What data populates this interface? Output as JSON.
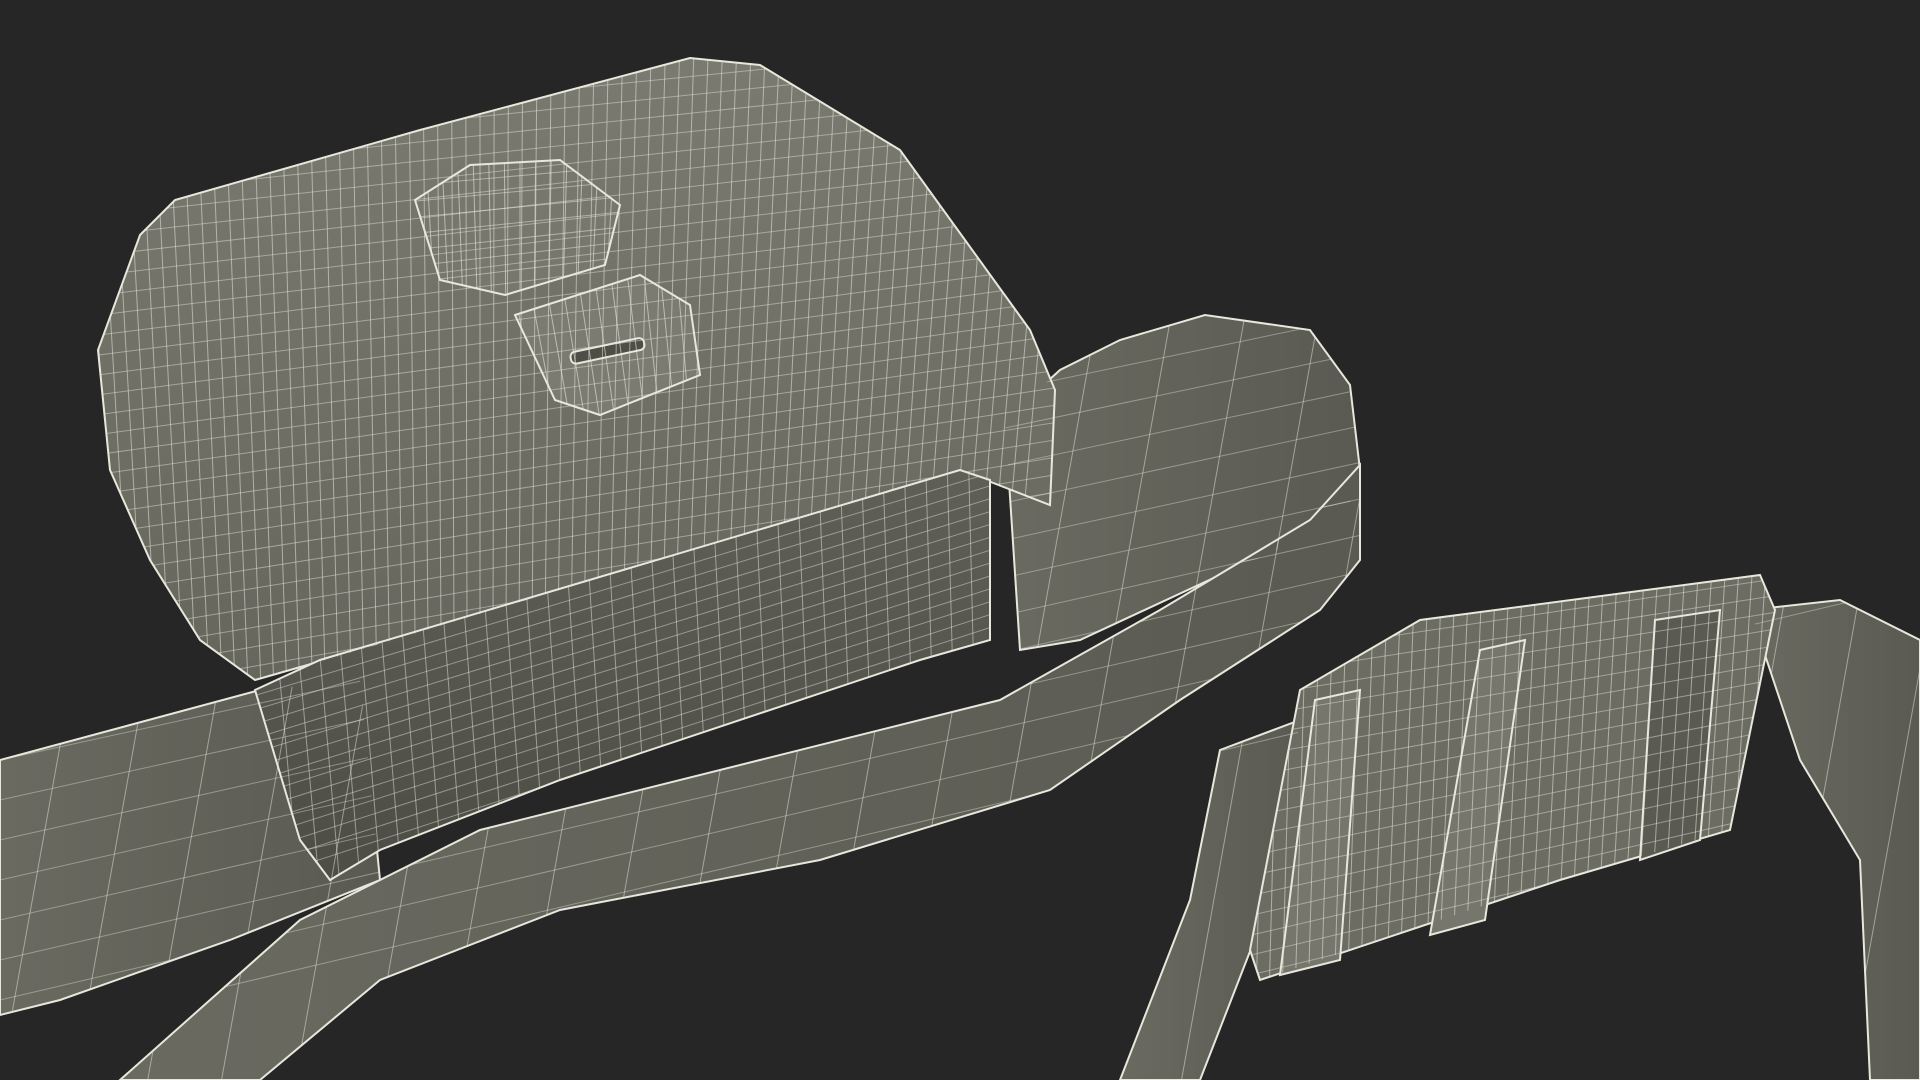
{
  "scene": {
    "subject": "",
    "background_color": "#262626",
    "mesh_fill_color": "#6e6e64",
    "mesh_fill_dark": "#55554d",
    "mesh_fill_light": "#85857a",
    "wire_color": "#e7e8dc"
  }
}
